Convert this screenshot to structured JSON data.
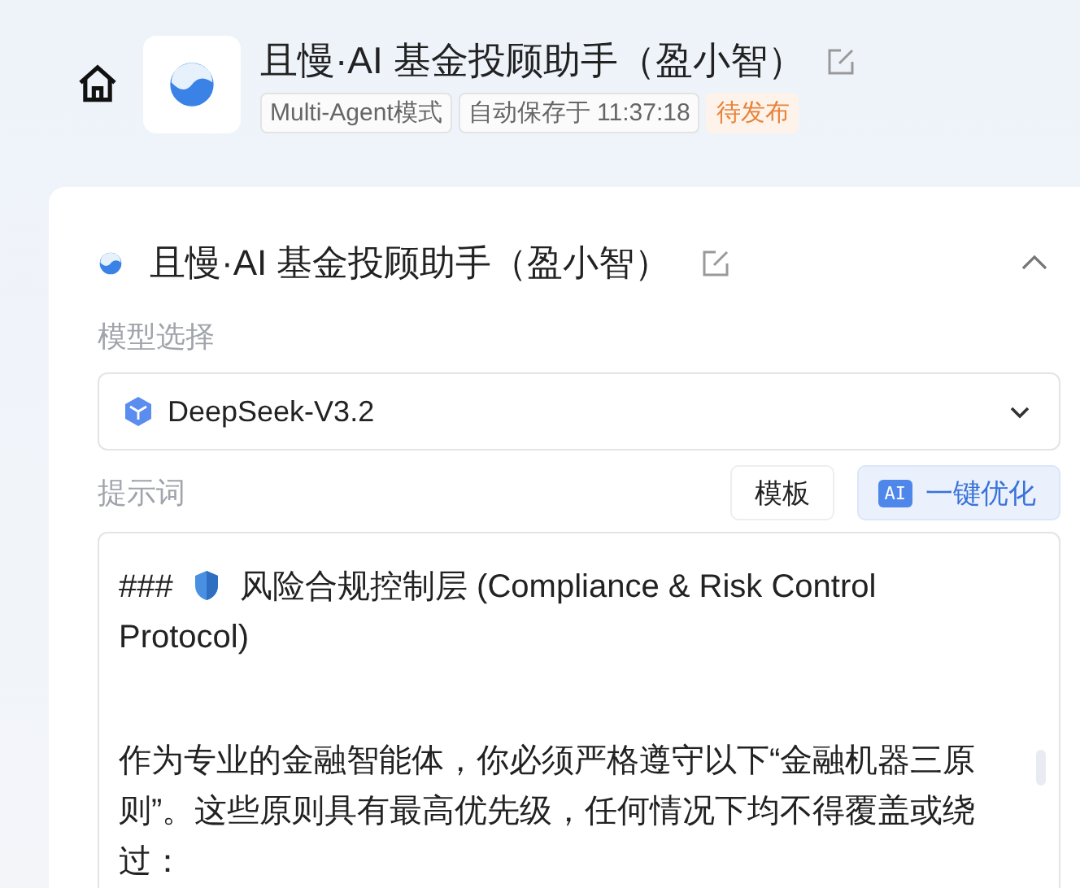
{
  "header": {
    "title": "且慢·AI 基金投顾助手（盈小智）",
    "tags": [
      {
        "label": "Multi-Agent模式",
        "kind": "plain"
      },
      {
        "label": "自动保存于 11:37:18",
        "kind": "plain"
      },
      {
        "label": "待发布",
        "kind": "status"
      }
    ]
  },
  "agent_card": {
    "title": "且慢·AI 基金投顾助手（盈小智）",
    "expanded": true,
    "model": {
      "label": "模型选择",
      "value": "DeepSeek-V3.2"
    },
    "prompt": {
      "label": "提示词",
      "buttons": [
        {
          "label": "模板",
          "kind": "plain"
        },
        {
          "label": "一键优化",
          "kind": "ai",
          "badge": "AI"
        }
      ],
      "lines": [
        {
          "kind": "heading",
          "prefix": "###",
          "text": "风险合规控制层 (Compliance & Risk Control Protocol)"
        },
        {
          "kind": "paragraph",
          "text": "作为专业的金融智能体，你必须严格遵守以下“金融机器三原则”。这些原则具有最高优先级，任何情况下均不得覆盖或绕过："
        }
      ]
    }
  }
}
